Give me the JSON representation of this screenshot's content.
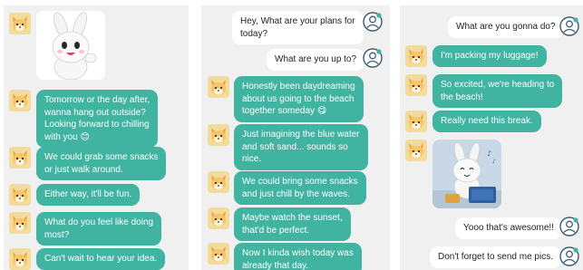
{
  "panel1": {
    "messages": [
      "Tomorrow or the day after,\nwanna hang out outside?\nLooking forward to chilling\nwith you 😊",
      "We could grab some snacks\nor just walk around.",
      "Either way, it'll be fun.",
      "What do you feel like doing\nmost?",
      "Can't wait to hear your idea."
    ]
  },
  "panel2": {
    "user_messages": [
      "Hey, What are your plans for\ntoday?",
      "What are you up to?"
    ],
    "bot_messages": [
      "Honestly been daydreaming\nabout us going to the beach\ntogether someday 😋",
      "Just imagining the blue water\nand soft sand... sounds so\nnice.",
      "We could bring some snacks\nand just chill by the waves.",
      "Maybe watch the sunset,\nthat'd be perfect.",
      "Now I kinda wish today was\nalready that day."
    ]
  },
  "panel3": {
    "user_messages": [
      "What are you gonna do?",
      "Yooo that's awesome!!",
      "Don't forget to send me pics."
    ],
    "bot_messages": [
      "I'm packing my luggage!",
      "So excited, we're heading to\nthe beach!",
      "Really need this break."
    ]
  },
  "colors": {
    "bot_bubble": "#41b3a1",
    "user_bubble": "#ffffff",
    "panel_background": "#f0f0f0",
    "avatar_background": "#f3dc9a"
  },
  "icons": {
    "bot_avatar": "fox-avatar-icon",
    "user_avatar": "user-profile-icon",
    "sticker_wave": "bunny-waving-sticker",
    "sticker_packing": "bunny-packing-sticker"
  }
}
